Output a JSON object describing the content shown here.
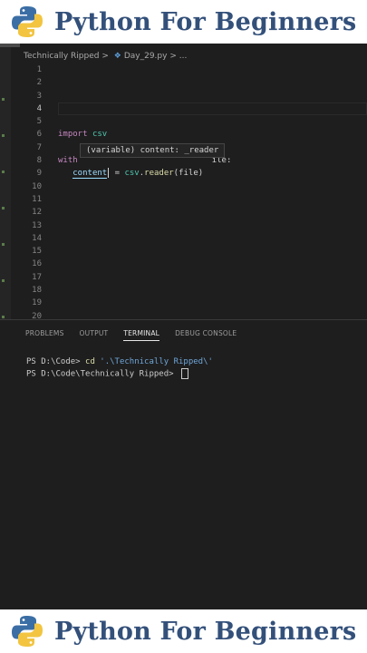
{
  "banner": {
    "title": "Python For Beginners",
    "logo_icon": "python-logo-icon",
    "title_color": "#33507a"
  },
  "breadcrumb": {
    "folder": "Technically Ripped",
    "separator": ">",
    "file": "Day_29.py",
    "trail": "> ..."
  },
  "editor": {
    "line_numbers": [
      "1",
      "2",
      "3",
      "4",
      "5",
      "6",
      "7",
      "8",
      "9",
      "10",
      "11",
      "12",
      "13",
      "14",
      "15",
      "16",
      "17",
      "18",
      "19",
      "20"
    ],
    "active_line": "4",
    "line6": {
      "keyword": "import",
      "module": "csv"
    },
    "line8": {
      "keyword": "with",
      "tail": "ile:"
    },
    "line9": {
      "var": "content",
      "op": " = ",
      "module": "csv",
      "dot": ".",
      "fn": "reader",
      "args": "(file)"
    },
    "tooltip": "(variable) content: _reader"
  },
  "panel": {
    "tabs": [
      "PROBLEMS",
      "OUTPUT",
      "TERMINAL",
      "DEBUG CONSOLE"
    ],
    "active_tab": "TERMINAL",
    "terminal": {
      "line1_prompt": "PS D:\\Code> ",
      "line1_cmd": "cd",
      "line1_arg": " '.\\Technically Ripped\\'",
      "line2_prompt": "PS D:\\Code\\Technically Ripped> "
    }
  },
  "colors": {
    "editor_bg": "#1e1e1e",
    "keyword": "#c586c0",
    "module": "#4ec9b0",
    "variable": "#9cdcfe",
    "function": "#dcdcaa"
  }
}
